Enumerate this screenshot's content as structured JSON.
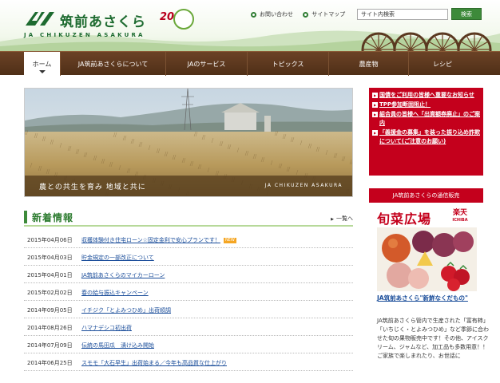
{
  "header": {
    "logo_text": "筑前あさくら",
    "logo_sub": "JA CHIKUZEN ASAKURA",
    "badge_number": "20",
    "util_links": [
      "お問い合わせ",
      "サイトマップ"
    ],
    "search_placeholder": "サイト内検索",
    "search_button": "検索"
  },
  "nav": {
    "items": [
      "ホーム",
      "JA筑前あさくらについて",
      "JAのサービス",
      "トピックス",
      "農産物",
      "レシピ"
    ]
  },
  "hero": {
    "slogan": "農との共生を育み 地域と共に",
    "brand": "JA CHIKUZEN ASAKURA"
  },
  "news": {
    "title": "新着情報",
    "more": "一覧へ",
    "new_label": "NEW",
    "items": [
      {
        "date": "2015年04月06日",
        "title": "収穫体験付き住宅ローン☆固定金利で安心プランです！",
        "new": true
      },
      {
        "date": "2015年04月03日",
        "title": "貯金規定の一部改正について",
        "new": false
      },
      {
        "date": "2015年04月01日",
        "title": "JA筑前あさくらのマイカーローン",
        "new": false
      },
      {
        "date": "2015年02月02日",
        "title": "春の給与振込キャンペーン",
        "new": false
      },
      {
        "date": "2014年09月05日",
        "title": "イチジク「とよみつひめ」出荷順調",
        "new": false
      },
      {
        "date": "2014年08月26日",
        "title": "ハマナデシコ初出荷",
        "new": false
      },
      {
        "date": "2014年07月09日",
        "title": "伝統の馬田瓜　漬け込み開始",
        "new": false
      },
      {
        "date": "2014年06月25日",
        "title": "スモモ「大石早生」出荷始まる／今年も高品質な仕上がり",
        "new": false
      }
    ]
  },
  "sidebar": {
    "notices": [
      "国債をご利用の皆様へ重要なお知らせ",
      "TPP参加断固阻止！",
      "組合員の皆様へ「出資額券廃止」のご案内",
      "「義援金の募集」を装った振り込め詐欺について(ご注意のお願い)"
    ],
    "shop_header": "JA筑前あさくらの通信販売",
    "shop_logo": "旬菜広場",
    "rakuten": "楽天",
    "rakuten_sub": "ICHIBA",
    "shop_link": "JA筑前あさくら\"新鮮なくだもの\"",
    "shop_desc": "JA筑前あさくら管内で生産された「富有柿」「いちじく・とよみつひめ」など季節に合わせた旬の果物販売中です！その他、アイスクリーム、ジャムなど、加工品も多数用意！！ご家族で楽しまれたり、お世話に"
  },
  "colors": {
    "brand_green": "#2f7d32",
    "nav_brown": "#5a3820",
    "notice_red": "#c4001c",
    "link_blue": "#1a4d9a"
  }
}
